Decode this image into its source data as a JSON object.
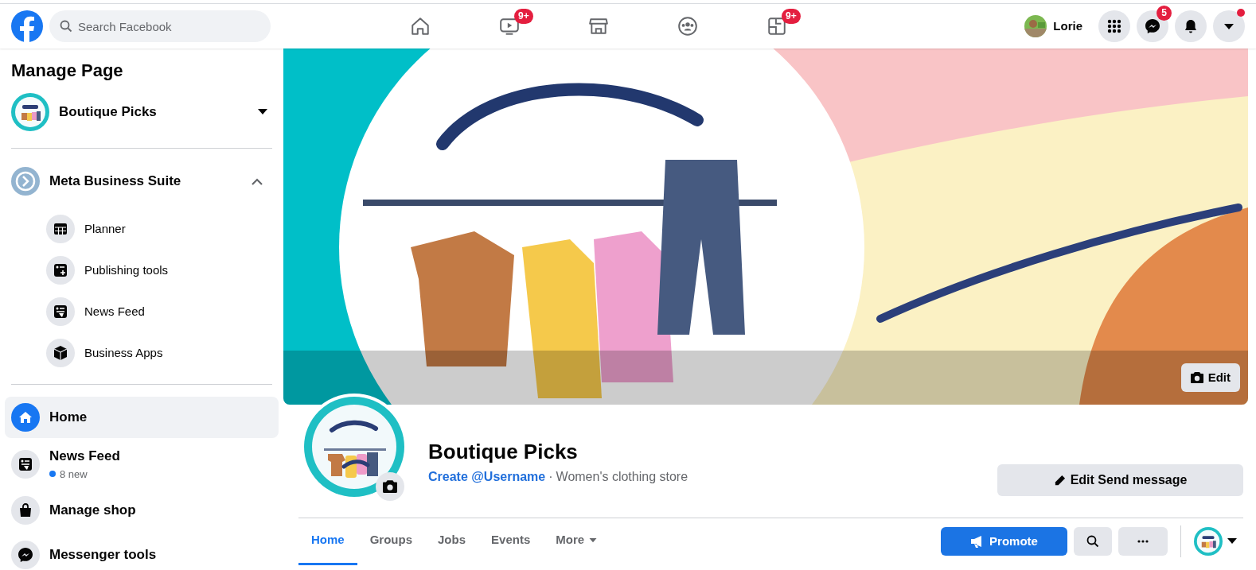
{
  "topbar": {
    "search": {
      "placeholder": "Search Facebook"
    },
    "nav": [
      {
        "kind": "home"
      },
      {
        "kind": "video",
        "badge": "9+"
      },
      {
        "kind": "store"
      },
      {
        "kind": "groups"
      },
      {
        "kind": "gaming",
        "badge": "9+"
      }
    ],
    "account": {
      "name": "Lorie"
    },
    "actions": [
      {
        "kind": "apps"
      },
      {
        "kind": "messenger",
        "badge": "5"
      },
      {
        "kind": "bell"
      },
      {
        "kind": "caret",
        "alert": true
      }
    ]
  },
  "sidebar": {
    "title": "Manage Page",
    "page": {
      "name": "Boutique Picks"
    },
    "suite": {
      "label": "Meta Business Suite",
      "expanded": true,
      "items": [
        {
          "kind": "planner",
          "label": "Planner"
        },
        {
          "kind": "publish",
          "label": "Publishing tools"
        },
        {
          "kind": "feed",
          "label": "News Feed"
        },
        {
          "kind": "apps",
          "label": "Business Apps"
        }
      ]
    },
    "nav": [
      {
        "kind": "home",
        "label": "Home",
        "selected": true
      },
      {
        "kind": "feed",
        "label": "News Feed",
        "note": "8 new",
        "selected": false
      },
      {
        "kind": "shop",
        "label": "Manage shop",
        "selected": false
      },
      {
        "kind": "messenger",
        "label": "Messenger tools",
        "selected": false
      }
    ]
  },
  "cover": {
    "edit_button": "Edit"
  },
  "profile": {
    "name": "Boutique Picks",
    "username_link": "Create @Username",
    "separator": "·",
    "category": "Women's clothing store",
    "button": "Edit Send message"
  },
  "tabs": [
    {
      "label": "Home",
      "selected": true
    },
    {
      "label": "Groups",
      "selected": false
    },
    {
      "label": "Jobs",
      "selected": false
    },
    {
      "label": "Events",
      "selected": false
    },
    {
      "label": "More",
      "selected": false,
      "kind": "dropdown"
    }
  ],
  "tab_actions": {
    "promote": "Promote"
  }
}
